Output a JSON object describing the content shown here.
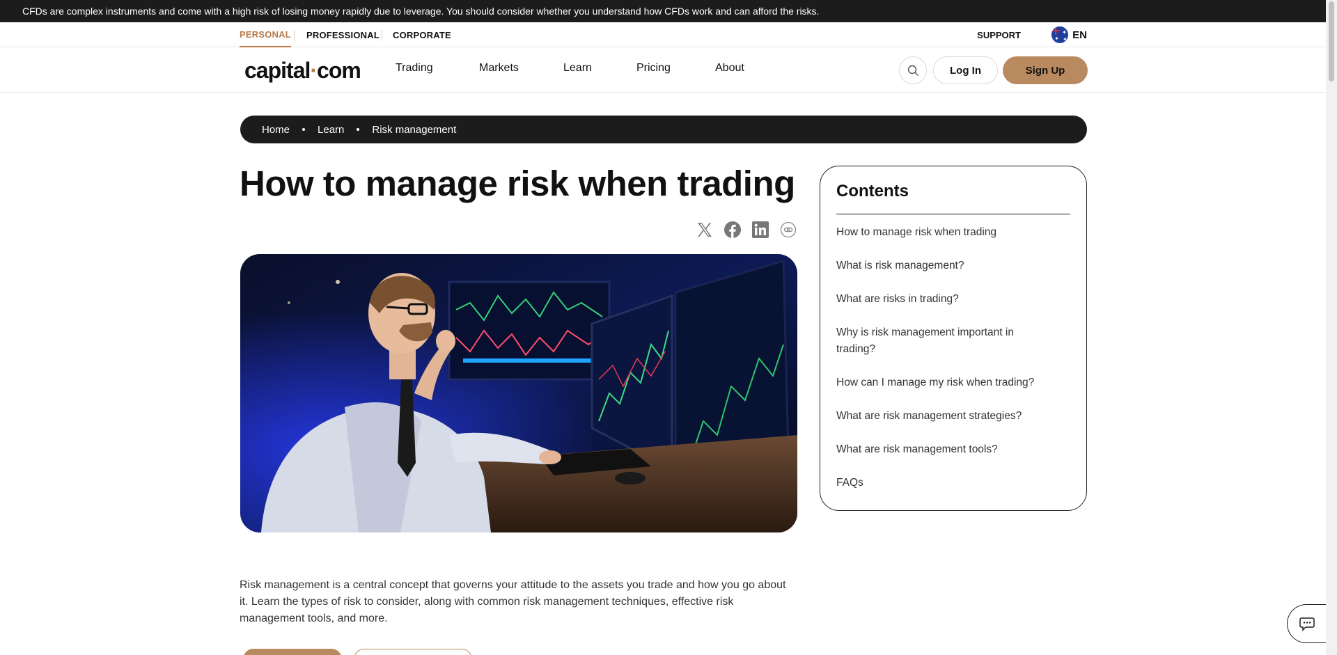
{
  "risk_warning": "CFDs are complex instruments and come with a high risk of losing money rapidly due to leverage. You should consider whether you understand how CFDs work and can afford the risks.",
  "top_nav": {
    "segments": [
      "PERSONAL",
      "PROFESSIONAL",
      "CORPORATE"
    ],
    "active_segment": "PERSONAL",
    "support": "SUPPORT",
    "language": "EN"
  },
  "header": {
    "logo_left": "capital",
    "logo_dot": "·",
    "logo_right": "com",
    "nav": [
      "Trading",
      "Markets",
      "Learn",
      "Pricing",
      "About"
    ],
    "login": "Log In",
    "signup": "Sign Up"
  },
  "breadcrumb": [
    "Home",
    "Learn",
    "Risk management"
  ],
  "article": {
    "title": "How to manage risk when trading",
    "share_icons": [
      "x-icon",
      "facebook-icon",
      "linkedin-icon",
      "copy-link-icon"
    ],
    "intro": "Risk management is a central concept that governs your attitude to the assets you trade and how you go about it. Learn the types of risk to consider, along with common risk management techniques, effective risk management tools, and more."
  },
  "contents": {
    "heading": "Contents",
    "items": [
      "How to manage risk when trading",
      "What is risk management?",
      "What are risks in trading?",
      "Why is risk management important in trading?",
      "How can I manage my risk when trading?",
      "What are risk management strategies?",
      "What are risk management tools?",
      "FAQs"
    ]
  },
  "colors": {
    "accent": "#b67a4a",
    "button": "#b98a60",
    "dark": "#1c1c1c"
  }
}
